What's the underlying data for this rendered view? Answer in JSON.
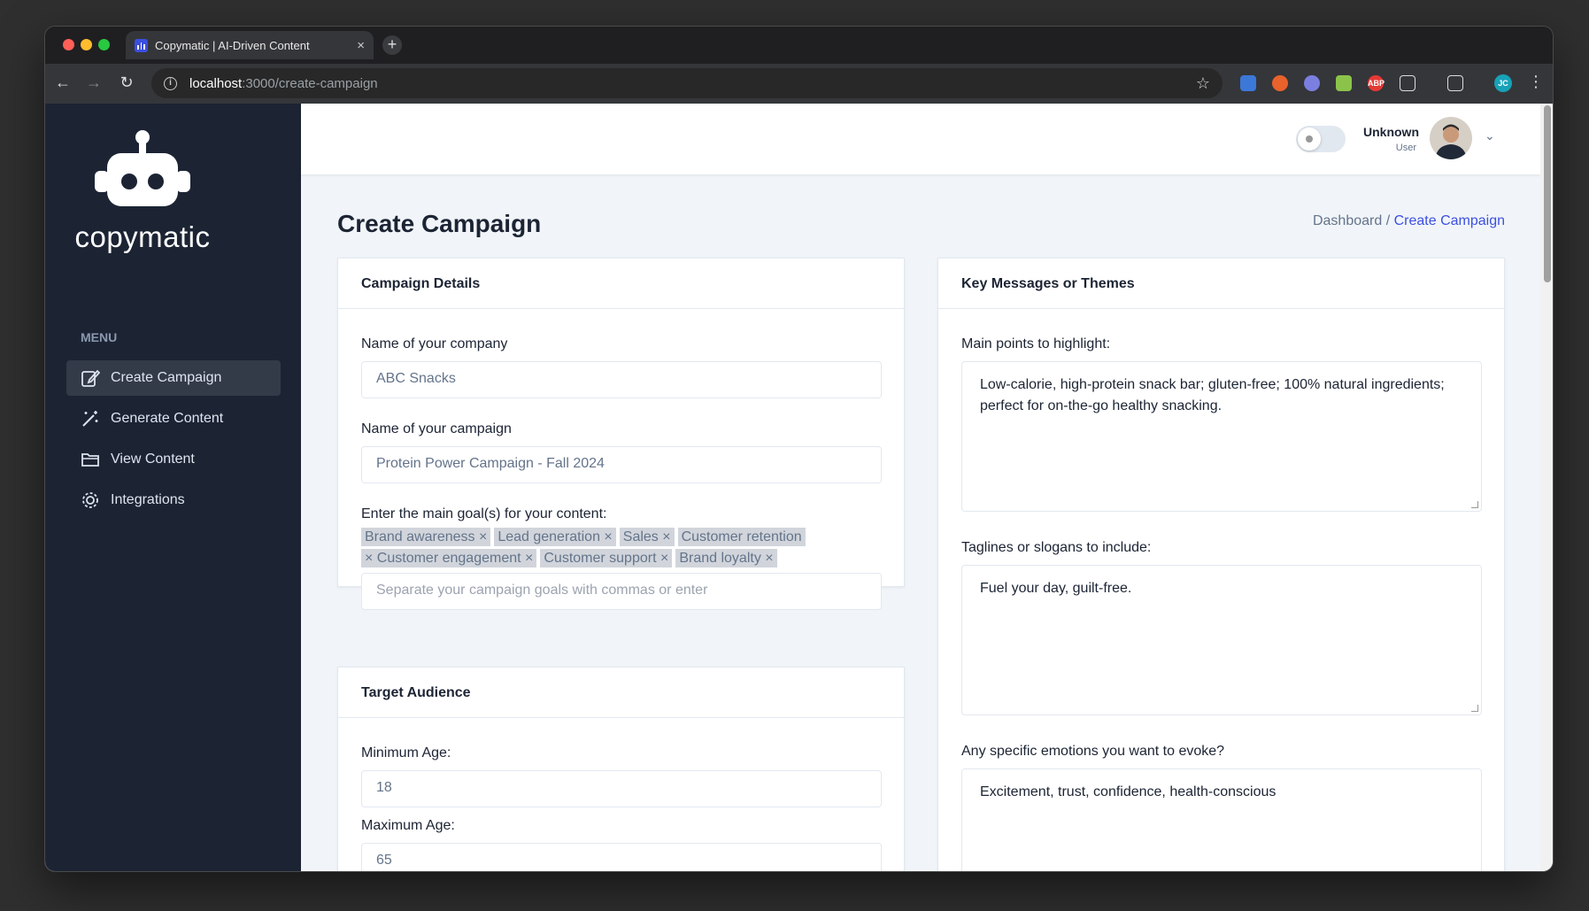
{
  "browser": {
    "tab_title": "Copymatic | AI-Driven Content",
    "tab_close": "×",
    "new_tab": "+",
    "url_host": "localhost",
    "url_path": ":3000/create-campaign",
    "profile_initials": "JC",
    "ext_abp": "ABP"
  },
  "sidebar": {
    "brand": "copymatic",
    "menu_label": "MENU",
    "items": [
      {
        "label": "Create Campaign",
        "icon": "edit-icon"
      },
      {
        "label": "Generate Content",
        "icon": "magic-wand-icon"
      },
      {
        "label": "View Content",
        "icon": "folder-icon"
      },
      {
        "label": "Integrations",
        "icon": "gear-icon"
      }
    ]
  },
  "header": {
    "user_name": "Unknown",
    "user_role": "User"
  },
  "main": {
    "title": "Create Campaign",
    "breadcrumb": {
      "parent": "Dashboard /",
      "current": "Create Campaign"
    },
    "campaign_details": {
      "heading": "Campaign Details",
      "company_label": "Name of your company",
      "company_value": "ABC Snacks",
      "campaign_label": "Name of your campaign",
      "campaign_value": "Protein Power Campaign - Fall 2024",
      "goals_label": "Enter the main goal(s) for your content:",
      "goals": [
        "Brand awareness",
        "Lead generation",
        "Sales",
        "Customer retention",
        "Customer engagement",
        "Customer support",
        "Brand loyalty"
      ],
      "goals_placeholder": "Separate your campaign goals with commas or enter"
    },
    "target_audience": {
      "heading": "Target Audience",
      "min_age_label": "Minimum Age:",
      "min_age_value": "18",
      "max_age_label": "Maximum Age:",
      "max_age_value": "65"
    },
    "key_messages": {
      "heading": "Key Messages or Themes",
      "points_label": "Main points to highlight:",
      "points_value": "Low-calorie, high-protein snack bar; gluten-free; 100% natural ingredients; perfect for on-the-go healthy snacking.",
      "taglines_label": "Taglines or slogans to include:",
      "taglines_value": "Fuel your day, guilt-free.",
      "emotions_label": "Any specific emotions you want to evoke?",
      "emotions_value": "Excitement, trust, confidence, health-conscious"
    }
  }
}
